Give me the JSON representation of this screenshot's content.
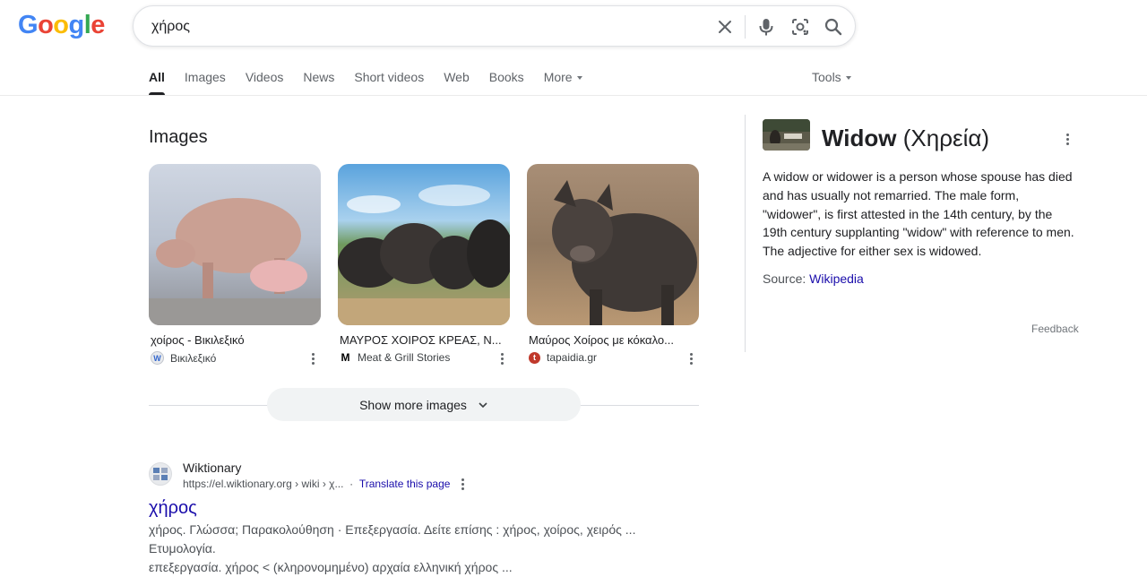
{
  "logo": {
    "letters": [
      "G",
      "o",
      "o",
      "g",
      "l",
      "e"
    ],
    "colors": [
      "#4285F4",
      "#EA4335",
      "#FBBC05",
      "#4285F4",
      "#34A853",
      "#EA4335"
    ]
  },
  "search": {
    "value": "χήρος",
    "icons": [
      "close-icon",
      "microphone-icon",
      "lens-icon",
      "search-icon"
    ]
  },
  "tabs": [
    {
      "label": "All",
      "active": true
    },
    {
      "label": "Images"
    },
    {
      "label": "Videos"
    },
    {
      "label": "News"
    },
    {
      "label": "Short videos"
    },
    {
      "label": "Web"
    },
    {
      "label": "Books"
    },
    {
      "label": "More",
      "dropdown": true
    }
  ],
  "tools": {
    "label": "Tools"
  },
  "images": {
    "heading": "Images",
    "items": [
      {
        "title": "χοίρος - Βικιλεξικό",
        "source": "Βικιλεξικό"
      },
      {
        "title": "ΜΑΥΡΟΣ ΧΟΙΡΟΣ ΚΡΕΑΣ, Ν...",
        "source": "Meat & Grill Stories"
      },
      {
        "title": "Μαύρος Χοίρος με κόκαλο...",
        "source": "tapaidia.gr"
      }
    ],
    "show_more": "Show more images"
  },
  "result": {
    "site": "Wiktionary",
    "url": "https://el.wiktionary.org › wiki › χ...",
    "translate": "Translate this page",
    "title": "χήρος",
    "snippet_line1": "χήρος. Γλώσσα; Παρακολούθηση · Επεξεργασία. Δείτε επίσης : χήρος, χοίρος, χειρός ... Ετυμολογία.",
    "snippet_line2": "επεξεργασία. χήρος < (κληρονομημένο) αρχαία ελληνική χήρος ..."
  },
  "knowledge_panel": {
    "title_main": "Widow",
    "title_sub": " (Χηρεία)",
    "description": "A widow or widower is a person whose spouse has died and has usually not remarried. The male form, \"widower\", is first attested in the 14th century, by the 19th century supplanting \"widow\" with reference to men. The adjective for either sex is widowed.",
    "source_label": "Source: ",
    "source_link": "Wikipedia",
    "feedback": "Feedback"
  }
}
